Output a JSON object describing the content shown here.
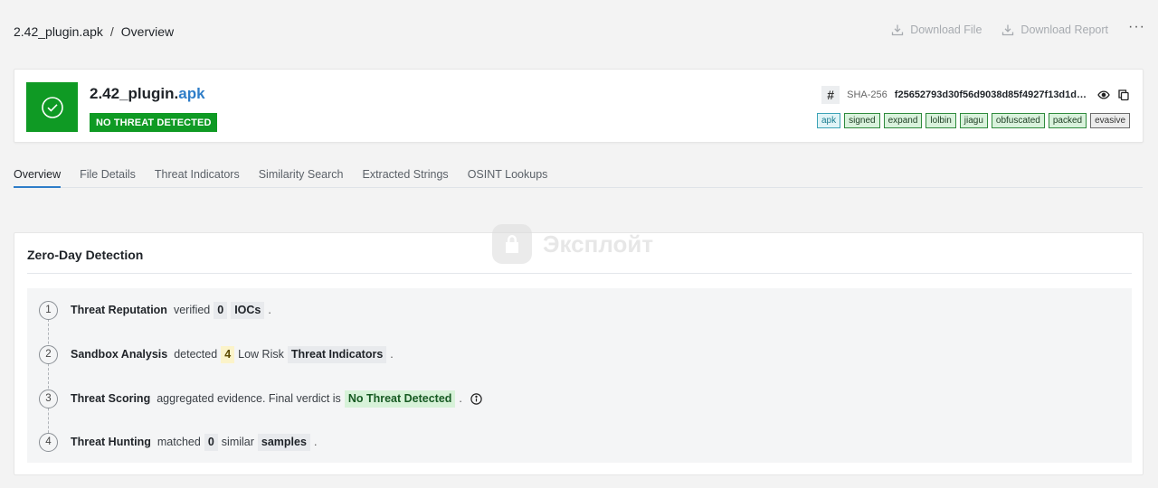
{
  "breadcrumb": {
    "file": "2.42_plugin.apk",
    "separator": "/",
    "current": "Overview"
  },
  "actions": {
    "download_file": "Download File",
    "download_report": "Download Report",
    "more": "···"
  },
  "file": {
    "name_base": "2.42_plugin.",
    "name_ext": "apk",
    "verdict": "NO THREAT DETECTED",
    "hash_symbol": "#",
    "hash_algo": "SHA-256",
    "hash_value": "f25652793d30f56d9038d85f4927f13d1d…",
    "tags": [
      "apk",
      "signed",
      "expand",
      "lolbin",
      "jiagu",
      "obfuscated",
      "packed",
      "evasive"
    ]
  },
  "tabs": [
    "Overview",
    "File Details",
    "Threat Indicators",
    "Similarity Search",
    "Extracted Strings",
    "OSINT Lookups"
  ],
  "watermark": {
    "text": "Эксплойт"
  },
  "zero_day": {
    "title": "Zero-Day Detection",
    "steps": [
      {
        "num": "1",
        "name": "Threat Reputation",
        "t1": "verified",
        "v1": "0",
        "t2": "",
        "v2": "IOCs",
        "end": "."
      },
      {
        "num": "2",
        "name": "Sandbox Analysis",
        "t1": "detected",
        "v1": "4",
        "t2": "Low Risk",
        "v2": "Threat Indicators",
        "end": "."
      },
      {
        "num": "3",
        "name": "Threat Scoring",
        "t1": "aggregated evidence. Final verdict is",
        "v1": "No Threat Detected",
        "end": "."
      },
      {
        "num": "4",
        "name": "Threat Hunting",
        "t1": "matched",
        "v1": "0",
        "t2": "similar",
        "v2": "samples",
        "end": "."
      }
    ]
  },
  "colors": {
    "verdict_green": "#0f9a24",
    "accent_blue": "#2e7dc8",
    "tag_green_bg": "#d9f2dc",
    "tag_green_border": "#2e8a3c"
  }
}
